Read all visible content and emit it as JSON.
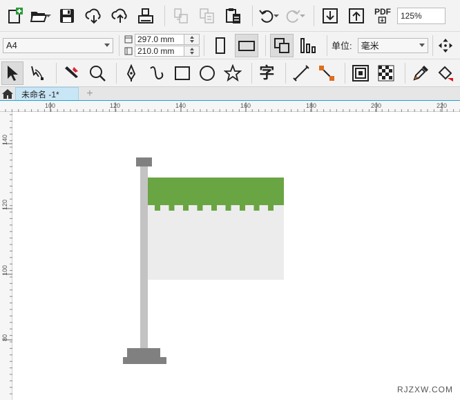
{
  "toolbar": {
    "buttons": [
      {
        "name": "new-document-button",
        "icon": "new-document-icon"
      },
      {
        "name": "open-button",
        "icon": "folder-open-icon"
      },
      {
        "name": "save-button",
        "icon": "floppy-disk-icon"
      },
      {
        "name": "cloud-download-button",
        "icon": "cloud-download-icon"
      },
      {
        "name": "cloud-upload-button",
        "icon": "cloud-upload-icon"
      },
      {
        "name": "print-button",
        "icon": "printer-icon"
      },
      {
        "name": "cut-button",
        "icon": "cut-icon"
      },
      {
        "name": "copy-button",
        "icon": "copy-icon"
      },
      {
        "name": "paste-button",
        "icon": "clipboard-icon"
      },
      {
        "name": "undo-button",
        "icon": "undo-icon"
      },
      {
        "name": "redo-button",
        "icon": "redo-icon"
      },
      {
        "name": "import-button",
        "icon": "import-icon"
      },
      {
        "name": "export-button",
        "icon": "export-icon"
      },
      {
        "name": "export-pdf-button",
        "icon": "pdf-icon"
      }
    ],
    "pdf_label": "PDF",
    "zoom_value": "125%"
  },
  "property_bar": {
    "page_size": "A4",
    "width_value": "297.0 mm",
    "height_value": "210.0 mm",
    "units_label": "单位:",
    "units_value": "毫米"
  },
  "toolbox": {
    "tools": [
      "pick-tool",
      "shape-tool",
      "crop-tool",
      "zoom-tool",
      "pen-tool",
      "freehand-tool",
      "rectangle-tool",
      "ellipse-tool",
      "polygon-tool",
      "text-tool",
      "dimension-tool",
      "connector-tool",
      "contour-tool",
      "transparency-tool",
      "eyedropper-tool",
      "fill-tool"
    ],
    "text_tool_glyph": "字"
  },
  "tabs": {
    "document_tab_label": "未命名 -1*",
    "add_tab_label": "+"
  },
  "rulers": {
    "horizontal_labels": [
      "100",
      "120",
      "140",
      "160",
      "180",
      "200",
      "220"
    ],
    "vertical_labels": [
      "140",
      "120",
      "100",
      "80"
    ]
  },
  "canvas": {
    "flag_color": "#6aa544",
    "panel_color": "#ececec",
    "pole_color": "#c3c3c3",
    "base_color": "#808080"
  },
  "watermark": "RJZXW.COM"
}
